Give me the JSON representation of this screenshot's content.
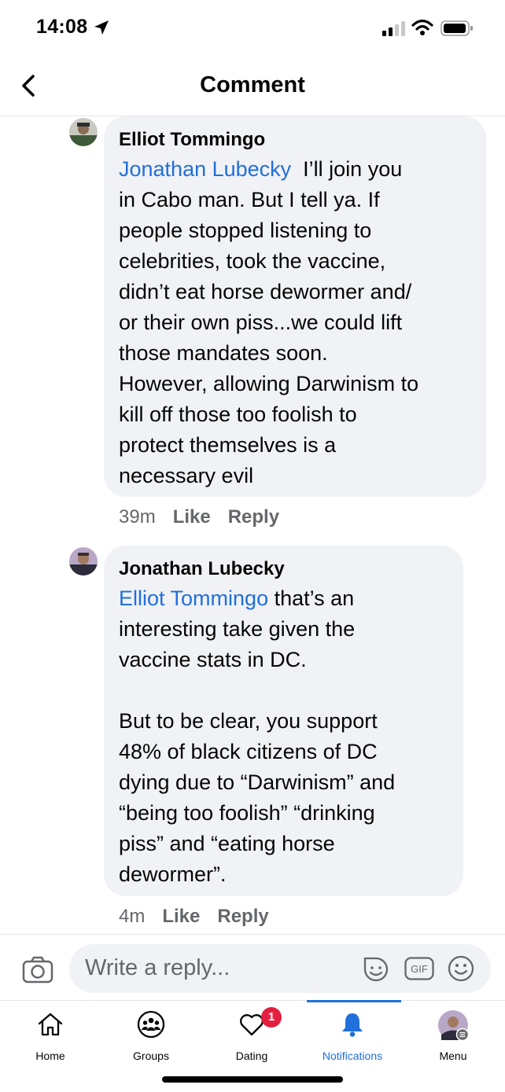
{
  "status": {
    "time": "14:08"
  },
  "header": {
    "title": "Comment"
  },
  "comments": [
    {
      "author": "Elliot Tommingo",
      "mention": "Jonathan Lubecky",
      "lines": [
        "  I’ll join you",
        "in Cabo man. But I tell ya. If",
        "people stopped listening to",
        "celebrities, took the vaccine,",
        "didn’t eat horse dewormer and/",
        "or their own piss...we could lift",
        "those mandates soon.",
        "However, allowing Darwinism to",
        "kill off those too foolish to",
        "protect themselves is a",
        "necessary evil"
      ],
      "time": "39m",
      "like_label": "Like",
      "reply_label": "Reply"
    },
    {
      "author": "Jonathan Lubecky",
      "mention": "Elliot Tommingo",
      "lines": [
        " that’s an",
        "interesting take given the",
        "vaccine stats in DC.",
        "",
        "But to be clear, you support",
        "48% of black citizens of DC",
        "dying due to “Darwinism” and",
        "“being too foolish” “drinking",
        "piss” and “eating horse",
        "dewormer”."
      ],
      "time": "4m",
      "like_label": "Like",
      "reply_label": "Reply"
    }
  ],
  "reply": {
    "placeholder": "Write a reply...",
    "gif_label": "GIF"
  },
  "tabs": [
    {
      "label": "Home",
      "icon": "home-icon"
    },
    {
      "label": "Groups",
      "icon": "groups-icon"
    },
    {
      "label": "Dating",
      "icon": "dating-icon",
      "badge": "1"
    },
    {
      "label": "Notifications",
      "icon": "bell-icon",
      "active": true
    },
    {
      "label": "Menu",
      "icon": "profile-avatar-icon"
    }
  ],
  "colors": {
    "accent": "#216fdb",
    "badge": "#e41e3f",
    "bubble": "#f0f2f5",
    "muted": "#65676b"
  }
}
